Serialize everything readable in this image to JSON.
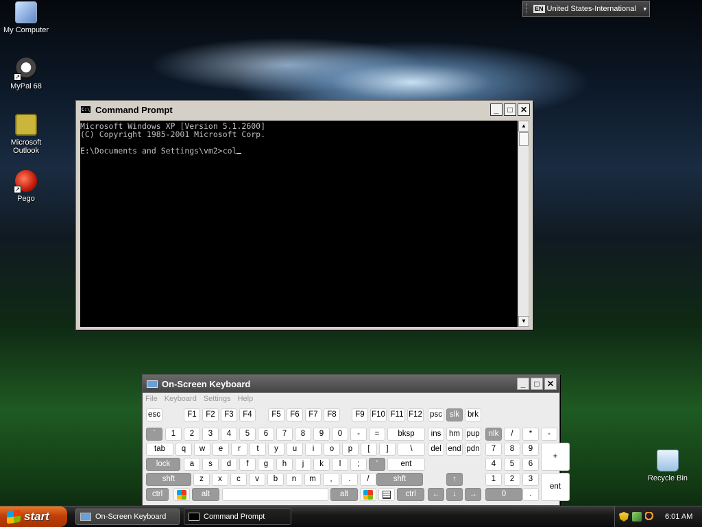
{
  "desktop": {
    "icons": [
      {
        "label": "My Computer",
        "icon": "my-computer-icon"
      },
      {
        "label": "MyPal 68",
        "icon": "mypal-browser-icon"
      },
      {
        "label": "Microsoft Outlook",
        "icon": "outlook-icon"
      },
      {
        "label": "Pego",
        "icon": "pego-icon"
      },
      {
        "label": "Recycle Bin",
        "icon": "recycle-bin-icon"
      }
    ]
  },
  "language_bar": {
    "code": "EN",
    "layout": "United States-International"
  },
  "cmd_window": {
    "title": "Command Prompt",
    "icon_text": "C:\\",
    "buttons": {
      "minimize": "_",
      "maximize": "□",
      "close": "✕"
    },
    "lines": [
      "Microsoft Windows XP [Version 5.1.2600]",
      "(C) Copyright 1985-2001 Microsoft Corp.",
      "",
      "E:\\Documents and Settings\\vm2>col"
    ]
  },
  "osk_window": {
    "title": "On-Screen Keyboard",
    "buttons": {
      "minimize": "_",
      "maximize": "□",
      "close": "✕"
    },
    "menu": [
      "File",
      "Keyboard",
      "Settings",
      "Help"
    ],
    "rows": [
      [
        "esc",
        "F1",
        "F2",
        "F3",
        "F4",
        "F5",
        "F6",
        "F7",
        "F8",
        "F9",
        "F10",
        "F11",
        "F12",
        "psc",
        "slk",
        "brk"
      ],
      [
        "`",
        "1",
        "2",
        "3",
        "4",
        "5",
        "6",
        "7",
        "8",
        "9",
        "0",
        "-",
        "=",
        "bksp",
        "ins",
        "hm",
        "pup",
        "nlk",
        "/",
        "*",
        "-"
      ],
      [
        "tab",
        "q",
        "w",
        "e",
        "r",
        "t",
        "y",
        "u",
        "i",
        "o",
        "p",
        "[",
        "]",
        "\\",
        "del",
        "end",
        "pdn",
        "7",
        "8",
        "9",
        "+"
      ],
      [
        "lock",
        "a",
        "s",
        "d",
        "f",
        "g",
        "h",
        "j",
        "k",
        "l",
        ";",
        "'",
        "ent",
        "4",
        "5",
        "6"
      ],
      [
        "shft",
        "z",
        "x",
        "c",
        "v",
        "b",
        "n",
        "m",
        ",",
        ".",
        "/",
        "shft",
        "↑",
        "1",
        "2",
        "3",
        "ent"
      ],
      [
        "ctrl",
        "alt",
        "alt",
        "ctrl",
        "←",
        "↓",
        "→",
        "0",
        "."
      ]
    ]
  },
  "taskbar": {
    "start_label": "start",
    "tasks": [
      {
        "label": "On-Screen Keyboard",
        "active": false
      },
      {
        "label": "Command Prompt",
        "active": true
      }
    ],
    "tray_icons": [
      "security-shield-icon",
      "network-icon",
      "search-icon"
    ],
    "clock": "6:01 AM"
  }
}
